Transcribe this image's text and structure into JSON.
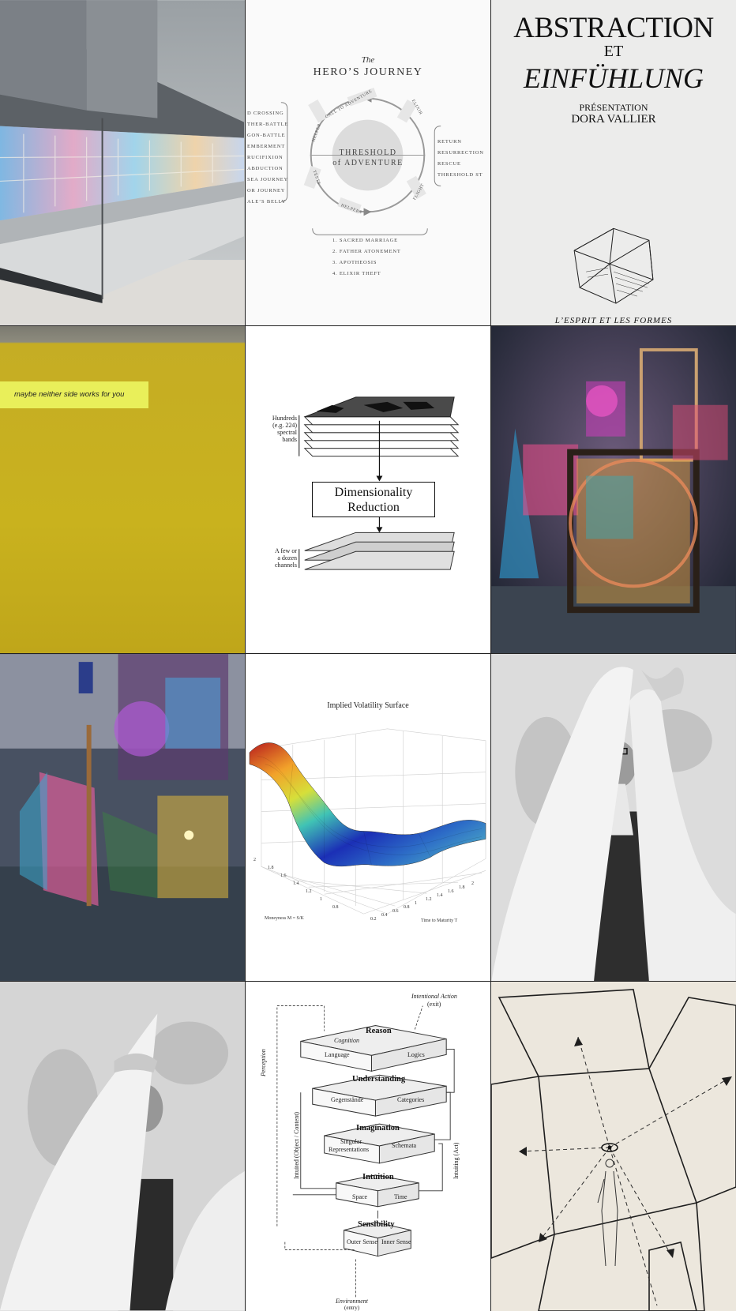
{
  "colors": {
    "grid_line": "#222222",
    "yellow_wall": "#c8b11c",
    "label_highlight": "#e9ef5a"
  },
  "tiles": {
    "hero_journey": {
      "title_small": "The",
      "title": "HERO’S JOURNEY",
      "center_line1": "THRESHOLD",
      "center_line2": "of ADVENTURE",
      "left_stages": [
        "D CROSSING",
        "THER-BATTLE",
        "GON-BATTLE",
        "EMBERMENT",
        "RUCIFIXION",
        "ABDUCTION",
        "SEA JOURNEY",
        "OR JOURNEY",
        "ALE’S BELLY"
      ],
      "right_stages": [
        "RETURN",
        "RESURRECTION",
        "RESCUE",
        "THRESHOLD ST"
      ],
      "bottom_stages": [
        "1. SACRED MARRIAGE",
        "2. FATHER ATONEMENT",
        "3. APOTHEOSIS",
        "4. ELIXIR THEFT"
      ],
      "circle_tags": {
        "call": "CALL TO ADVENTURE",
        "elixir": "ELIXIR",
        "helper": "HELPER",
        "tests": "TESTS",
        "helpers": "HELPERS",
        "flight": "FLIGHT"
      }
    },
    "book_cover": {
      "line1": "ABSTRACTION",
      "line2": "ET",
      "line3": "EINFÜHLUNG",
      "presentation": "PRÉSENTATION",
      "author": "DORA VALLIER",
      "series": "L’ESPRIT ET LES FORMES"
    },
    "yellow_wall": {
      "label": "maybe neither side works for you"
    },
    "dimensionality": {
      "box_line1": "Dimensionality",
      "box_line2": "Reduction",
      "top_label": [
        "Hundreds",
        "(e.g. 224)",
        "spectral",
        "bands"
      ],
      "bottom_label": [
        "A few or",
        "a dozen",
        "channels"
      ]
    },
    "volatility": {
      "title": "Implied Volatility Surface",
      "moneyness_ticks": [
        "2",
        "1.8",
        "1.6",
        "1.4",
        "1.2",
        "1",
        "0.8"
      ],
      "maturity_ticks": [
        "0.2",
        "0.4",
        "0.6",
        "0.8",
        "1",
        "1.2",
        "1.4",
        "1.6",
        "1.8",
        "2"
      ],
      "moneyness_label": "Moneyness M = S/K",
      "maturity_label": "Time to Maturity T"
    },
    "kant_diagram": {
      "intentional_action": "Intentional Action",
      "exit": "(exit)",
      "reason": "Reason",
      "cognition": "Cognition",
      "language": "Language",
      "logics": "Logics",
      "understanding": "Understanding",
      "gegenstande": "Gegenstände",
      "categories": "Categories",
      "imagination": "Imagination",
      "singular1": "Singular",
      "singular2": "Representations",
      "schemata": "Schemata",
      "intuition": "Intuition",
      "space": "Space",
      "time": "Time",
      "sensibility": "Sensibility",
      "outer_sense": "Outer Sense",
      "inner_sense": "Inner Sense",
      "perception": "Perception",
      "intuited": "Intuited (Object / Content)",
      "intuiting": "Intuiting (Act)",
      "environment": "Environment",
      "entry": "(entry)"
    }
  }
}
